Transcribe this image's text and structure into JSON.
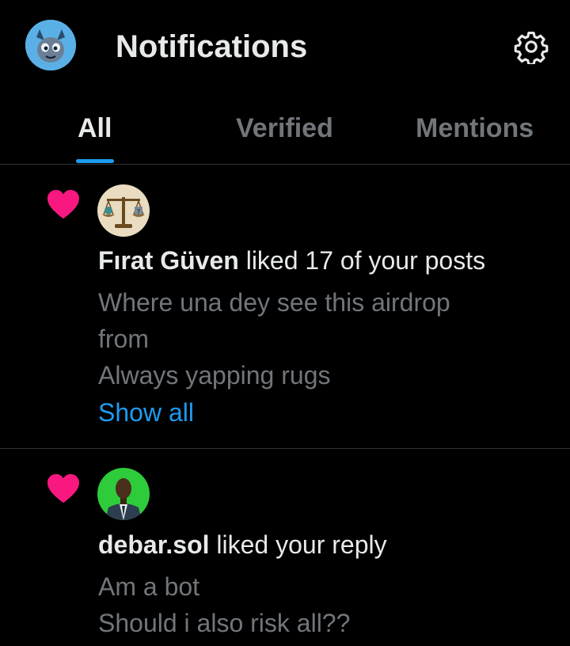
{
  "header": {
    "title": "Notifications",
    "profile_avatar_icon": "cartoon-avatar-icon",
    "settings_icon": "gear-icon"
  },
  "tabs": [
    {
      "label": "All",
      "active": true
    },
    {
      "label": "Verified",
      "active": false
    },
    {
      "label": "Mentions",
      "active": false
    }
  ],
  "notifications": [
    {
      "type_icon": "heart-icon",
      "user": "Fırat Güven",
      "action": " liked 17 of your posts",
      "text_lines": [
        "Where una dey see this airdrop",
        "from",
        "Always yapping rugs"
      ],
      "link": "Show all"
    },
    {
      "type_icon": "heart-icon",
      "user": "debar.sol",
      "action": " liked your reply",
      "text_lines": [
        "Am a bot",
        "Should i also risk all??"
      ]
    }
  ],
  "colors": {
    "background": "#000000",
    "accent": "#1d9bf0",
    "like": "#f91880",
    "muted": "#71767b",
    "text": "#e7e9ea",
    "divider": "#2f3336"
  }
}
